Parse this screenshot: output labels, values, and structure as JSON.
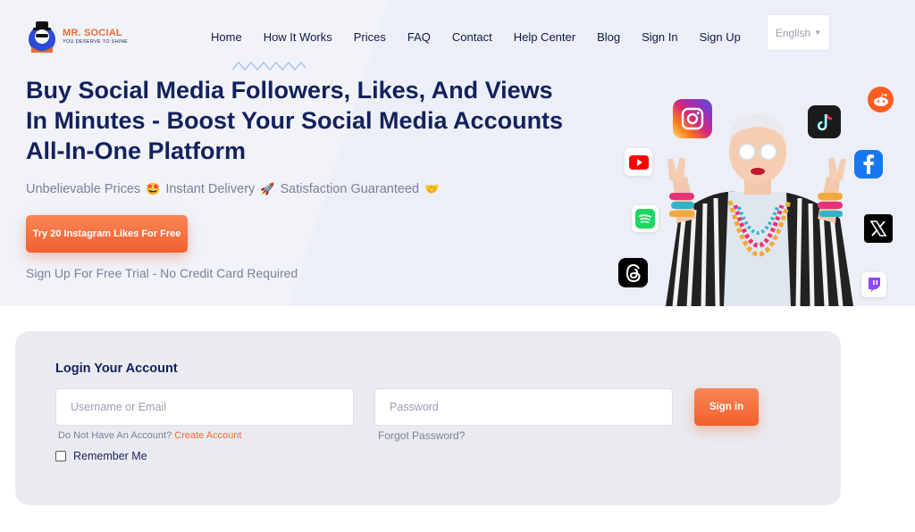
{
  "brand": {
    "name": "MR. SOCIAL",
    "tagline": "YOU DESERVE TO SHINE",
    "accent": "#f06a2f",
    "navy": "#13215c"
  },
  "nav": {
    "items": [
      {
        "label": "Home"
      },
      {
        "label": "How It Works"
      },
      {
        "label": "Prices"
      },
      {
        "label": "FAQ"
      },
      {
        "label": "Contact"
      },
      {
        "label": "Help Center"
      },
      {
        "label": "Blog"
      },
      {
        "label": "Sign In"
      },
      {
        "label": "Sign Up"
      }
    ],
    "language": "English"
  },
  "hero": {
    "headline": "Buy Social Media Followers, Likes, And Views In Minutes - Boost Your Social Media Accounts All-In-One Platform",
    "features": [
      {
        "text": "Unbelievable Prices",
        "emoji": "🤩"
      },
      {
        "text": "Instant Delivery",
        "emoji": "🚀"
      },
      {
        "text": "Satisfaction Guaranteed",
        "emoji": "🤝"
      }
    ],
    "cta_label": "Try 20 Instagram Likes For Free",
    "trial_note": "Sign Up For Free Trial - No Credit Card Required",
    "social_icons": [
      "instagram-icon",
      "tiktok-icon",
      "reddit-icon",
      "youtube-icon",
      "facebook-icon",
      "spotify-icon",
      "x-icon",
      "threads-icon",
      "twitch-icon"
    ]
  },
  "login": {
    "title": "Login Your Account",
    "username_placeholder": "Username or Email",
    "password_placeholder": "Password",
    "signin_label": "Sign in",
    "no_account_text": "Do Not Have An Account?",
    "create_account_label": "Create Account",
    "forgot_label": "Forgot Password?",
    "remember_label": "Remember Me"
  }
}
